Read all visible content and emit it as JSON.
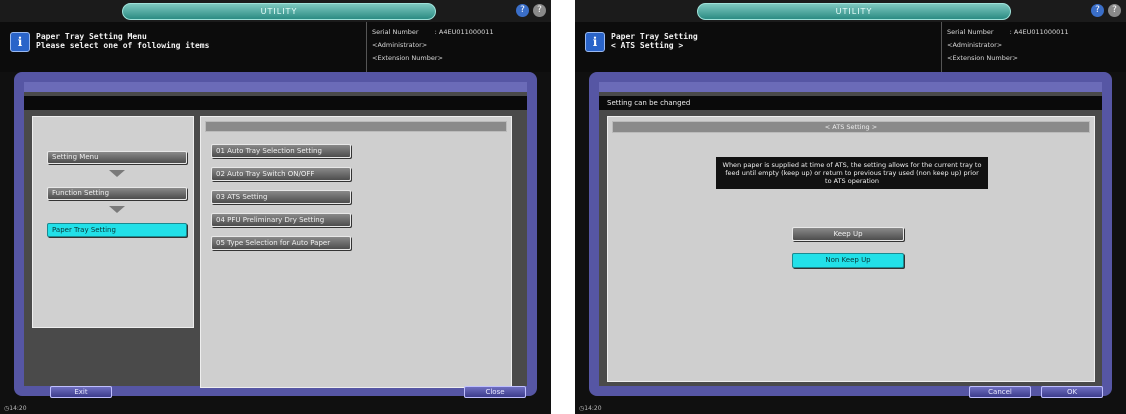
{
  "left": {
    "title_pill": "UTILITY",
    "header_line1": "Paper Tray Setting Menu",
    "header_line2": "Please select one of following items",
    "serial_label": "Serial Number",
    "serial_value": ": A4EU011000011",
    "administrator": "<Administrator>",
    "extension": "<Extension Number>",
    "nav": [
      "Setting Menu",
      "Function Setting",
      "Paper Tray Setting"
    ],
    "options": [
      "01 Auto Tray Selection Setting",
      "02 Auto Tray Switch ON/OFF",
      "03 ATS Setting",
      "04 PFU Preliminary Dry Setting",
      "05 Type Selection for Auto Paper"
    ],
    "exit_label": "Exit",
    "close_label": "Close",
    "clock": "14:20"
  },
  "right": {
    "title_pill": "UTILITY",
    "header_line1": "Paper Tray Setting",
    "header_line2": "< ATS Setting >",
    "serial_label": "Serial Number",
    "serial_value": ": A4EU011000011",
    "administrator": "<Administrator>",
    "extension": "<Extension Number>",
    "status": "Setting can be changed",
    "panel_title": "< ATS Setting >",
    "message": "When paper is supplied at time of ATS, the setting allows for the current tray to feed until empty (keep up) or return to previous tray used (non keep up) prior to ATS operation",
    "keep_up": "Keep Up",
    "non_keep_up": "Non Keep Up",
    "cancel_label": "Cancel",
    "ok_label": "OK",
    "clock": "14:20"
  },
  "colors": {
    "accent_cyan": "#22e0e8",
    "frame_blue": "#5656a4",
    "info_blue": "#2a64c9"
  },
  "icons": [
    "info-icon",
    "help-icon",
    "question-icon",
    "clock-icon"
  ]
}
